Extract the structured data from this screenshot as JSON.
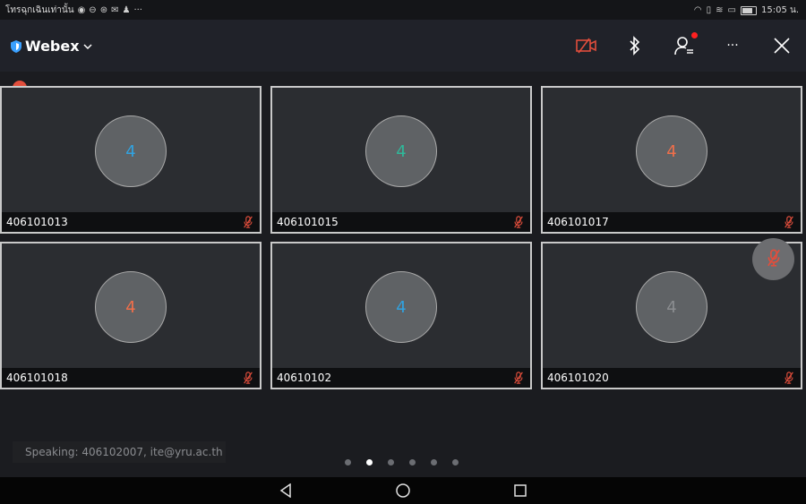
{
  "status_bar": {
    "carrier": "โทรฉุกเฉินเท่านั้น",
    "time": "15:05 น.",
    "icons_left": [
      "circle-ok-icon",
      "minus-circle-icon",
      "settings-circle-icon",
      "mail-icon",
      "notification-icon",
      "more-icon"
    ],
    "icons_right": [
      "headset-icon",
      "vibrate-icon",
      "wifi-icon",
      "sim-icon",
      "battery-icon"
    ]
  },
  "header": {
    "brand": "Webex",
    "more_label": "···",
    "colors": {
      "brand_shield": "#3aa0ff",
      "camera_off": "#e24e3c",
      "notification": "#ff2020"
    }
  },
  "participants": [
    {
      "name": "406101013",
      "initial": "4",
      "initial_color": "#31a2e0"
    },
    {
      "name": "406101015",
      "initial": "4",
      "initial_color": "#2fb89a"
    },
    {
      "name": "406101017",
      "initial": "4",
      "initial_color": "#f06f4a"
    },
    {
      "name": "406101018",
      "initial": "4",
      "initial_color": "#f06f4a"
    },
    {
      "name": "40610102",
      "initial": "4",
      "initial_color": "#31a2e0"
    },
    {
      "name": "406101020",
      "initial": "4",
      "initial_color": "#8b8d90"
    }
  ],
  "mute_color": "#e24e3c",
  "speaking": "Speaking: 406102007, ite@yru.ac.th",
  "pager": {
    "pages": 6,
    "active": 2
  }
}
